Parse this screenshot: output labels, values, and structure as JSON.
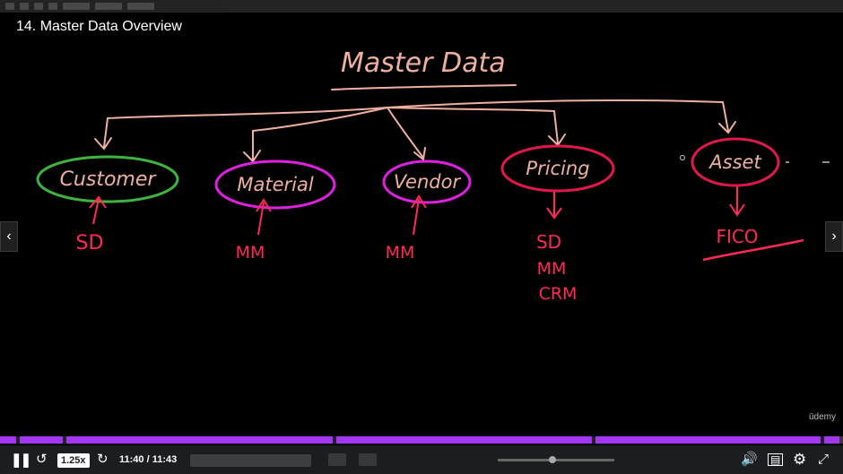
{
  "lecture": {
    "title": "14. Master Data Overview"
  },
  "board": {
    "heading": "Master Data",
    "nodes": [
      {
        "label": "Customer",
        "color": "#3fb33f",
        "modules": [
          "SD"
        ]
      },
      {
        "label": "Material",
        "color": "#e020e0",
        "modules": [
          "MM"
        ]
      },
      {
        "label": "Vendor",
        "color": "#e020e0",
        "modules": [
          "MM"
        ]
      },
      {
        "label": "Pricing",
        "color": "#e0184a",
        "modules": [
          "SD",
          "MM",
          "CRM"
        ]
      },
      {
        "label": "Asset",
        "color": "#e0184a",
        "modules": [
          "FICO"
        ]
      }
    ],
    "ink_colors": {
      "chalk": "#f0b0a0",
      "module": "#ff2a55"
    }
  },
  "player": {
    "speed_label": "1.25x",
    "time_label": "11:40 / 11:43",
    "progress_fraction": 0.9957,
    "brand_watermark": "ūdemy",
    "accent": "#a435f0"
  },
  "icons": {
    "prev": "chevron-left-icon",
    "next": "chevron-right-icon",
    "play_pause": "pause-icon",
    "rewind": "rewind-icon",
    "forward": "forward-icon",
    "volume": "volume-icon",
    "captions": "captions-icon",
    "settings": "gear-icon",
    "fullscreen": "fullscreen-icon"
  }
}
